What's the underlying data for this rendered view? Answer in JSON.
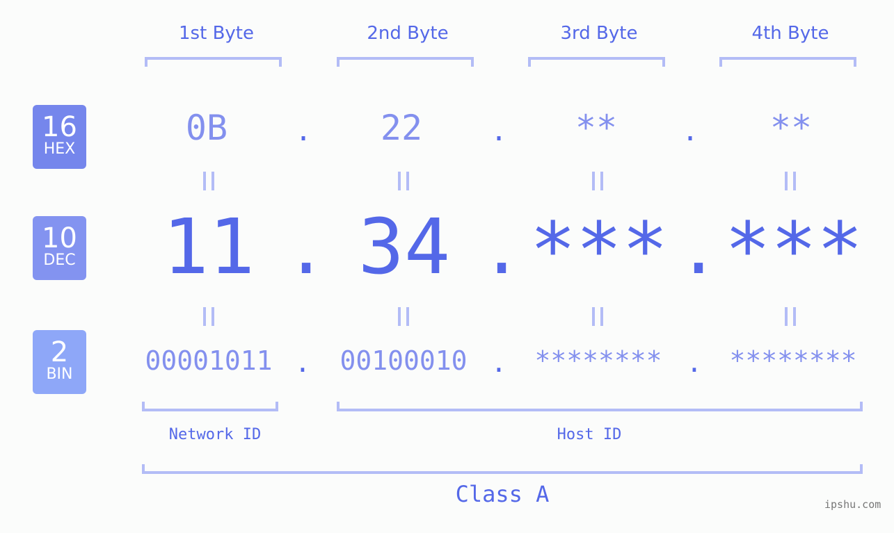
{
  "bytes": {
    "labels": [
      "1st Byte",
      "2nd Byte",
      "3rd Byte",
      "4th Byte"
    ]
  },
  "bases": {
    "hex": {
      "num": "16",
      "label": "HEX",
      "color": "#7586ec"
    },
    "dec": {
      "num": "10",
      "label": "DEC",
      "color": "#8393f0"
    },
    "bin": {
      "num": "2",
      "label": "BIN",
      "color": "#8ea7f8"
    }
  },
  "values": {
    "hex": [
      "0B",
      "22",
      "**",
      "**"
    ],
    "dec": [
      "11",
      "34",
      "***",
      "***"
    ],
    "bin": [
      "00001011",
      "00100010",
      "********",
      "********"
    ],
    "separator": "."
  },
  "sections": {
    "network_id": "Network ID",
    "host_id": "Host ID",
    "class": "Class A"
  },
  "colors": {
    "accent": "#5468e8",
    "light": "#8390ee",
    "bracket": "#b3bcf6"
  },
  "watermark": "ipshu.com"
}
